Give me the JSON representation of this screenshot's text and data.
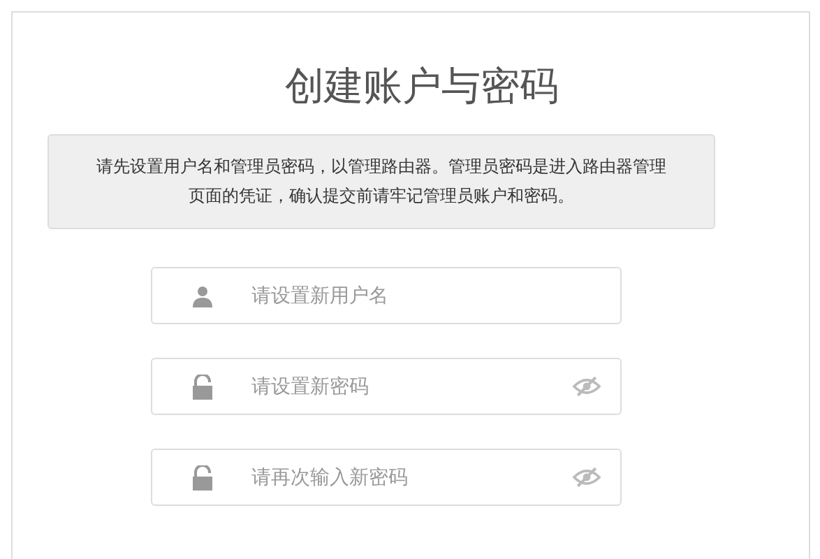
{
  "title": "创建账户与密码",
  "notice": "请先设置用户名和管理员密码，以管理路由器。管理员密码是进入路由器管理页面的凭证，确认提交前请牢记管理员账户和密码。",
  "fields": [
    {
      "kind": "username",
      "placeholder": "请设置新用户名"
    },
    {
      "kind": "password",
      "placeholder": "请设置新密码"
    },
    {
      "kind": "password",
      "placeholder": "请再次输入新密码"
    }
  ]
}
